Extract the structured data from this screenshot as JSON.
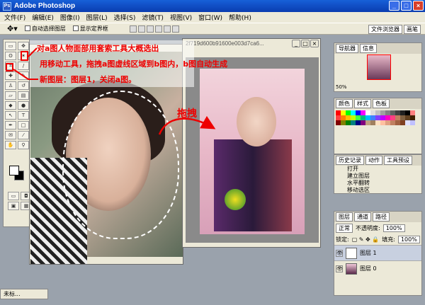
{
  "app": {
    "title": "Adobe Photoshop",
    "win_min": "_",
    "win_max": "□",
    "win_close": "×"
  },
  "menu": [
    "文件(F)",
    "编辑(E)",
    "图像(I)",
    "图层(L)",
    "选择(S)",
    "滤镜(T)",
    "视图(V)",
    "窗口(W)",
    "帮助(H)"
  ],
  "options": {
    "auto_select": "自动选择图层",
    "show_bounds": "显示定界框"
  },
  "palette_well": [
    "文件浏览器",
    "画笔"
  ],
  "doc_b": {
    "title": "2f719d600b91600e003d7ca6..."
  },
  "minimized": {
    "label": "未标..."
  },
  "panels": {
    "navigator": {
      "tabs": [
        "导航器",
        "信息"
      ],
      "zoom": "50%"
    },
    "color": {
      "tabs": [
        "颜色",
        "样式",
        "色板"
      ]
    },
    "history": {
      "tabs": [
        "历史记录",
        "动作",
        "工具预设"
      ],
      "items": [
        "打开",
        "建立图层",
        "水平翻转",
        "移动选区"
      ]
    },
    "layers": {
      "tabs": [
        "图层",
        "通道",
        "路径"
      ],
      "mode": "正常",
      "opacity_label": "不透明度:",
      "opacity": "100%",
      "lock_label": "锁定:",
      "fill_label": "填充:",
      "fill": "100%",
      "items": [
        "图层 1",
        "图层 0"
      ]
    }
  },
  "annotations": {
    "line1": "对a图人物面部用套索工具大概选出",
    "line2": "用移动工具，拖拽a图虚线区域到b图内，b图自动生成",
    "line3": "新图层：图层1，关闭a图。",
    "drag": "拖拽"
  },
  "swatches": [
    "#ff0000",
    "#ffff00",
    "#00ff00",
    "#00ffff",
    "#0000ff",
    "#ff00ff",
    "#ffffff",
    "#e0e0e0",
    "#c0c0c0",
    "#a0a0a0",
    "#808080",
    "#606060",
    "#404040",
    "#202020",
    "#000000",
    "#ff8080",
    "#ff4040",
    "#ff8000",
    "#ffc000",
    "#c0ff00",
    "#40ff40",
    "#00c080",
    "#00c0ff",
    "#4080ff",
    "#8040ff",
    "#c000ff",
    "#ff00c0",
    "#ff4080",
    "#c08060",
    "#806040",
    "#604020",
    "#402000",
    "#800000",
    "#808000",
    "#008000",
    "#008080",
    "#000080",
    "#800080",
    "#c0a080",
    "#a08060",
    "#ffe0c0",
    "#ffc0a0",
    "#e0a080",
    "#c08060",
    "#a06040",
    "#804020",
    "#e0e0ff",
    "#c0c0ff"
  ]
}
